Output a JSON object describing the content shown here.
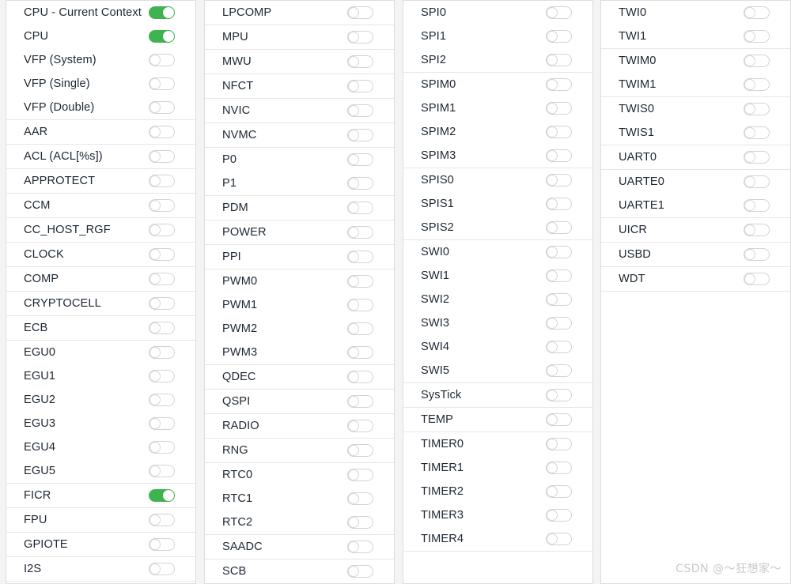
{
  "window": {
    "background_color": "#f4f4f4",
    "panel_color": "#ffffff",
    "panel_border_color": "#dddddd",
    "separator_color": "#e6e6e6",
    "label_color": "#1d2733",
    "toggle_on_color": "#3fb34f",
    "toggle_off_color": "#d3d3d3"
  },
  "watermark": {
    "text": "CSDN @～狂想家～"
  },
  "columns": [
    {
      "id": "column-1",
      "groups": [
        {
          "id": "group-cpu",
          "items": [
            {
              "label": "CPU - Current Context",
              "state": "on"
            },
            {
              "label": "CPU",
              "state": "on"
            },
            {
              "label": "VFP (System)",
              "state": "off"
            },
            {
              "label": "VFP (Single)",
              "state": "off"
            },
            {
              "label": "VFP (Double)",
              "state": "off"
            }
          ]
        },
        {
          "id": "group-aar",
          "items": [
            {
              "label": "AAR",
              "state": "off"
            }
          ]
        },
        {
          "id": "group-acl",
          "items": [
            {
              "label": "ACL (ACL[%s])",
              "state": "off"
            }
          ]
        },
        {
          "id": "group-approtect",
          "items": [
            {
              "label": "APPROTECT",
              "state": "off"
            }
          ]
        },
        {
          "id": "group-ccm",
          "items": [
            {
              "label": "CCM",
              "state": "off"
            }
          ]
        },
        {
          "id": "group-cc-host-rgf",
          "items": [
            {
              "label": "CC_HOST_RGF",
              "state": "off"
            }
          ]
        },
        {
          "id": "group-clock",
          "items": [
            {
              "label": "CLOCK",
              "state": "off"
            }
          ]
        },
        {
          "id": "group-comp",
          "items": [
            {
              "label": "COMP",
              "state": "off"
            }
          ]
        },
        {
          "id": "group-cryptocell",
          "items": [
            {
              "label": "CRYPTOCELL",
              "state": "off"
            }
          ]
        },
        {
          "id": "group-ecb",
          "items": [
            {
              "label": "ECB",
              "state": "off"
            }
          ]
        },
        {
          "id": "group-egu",
          "items": [
            {
              "label": "EGU0",
              "state": "off"
            },
            {
              "label": "EGU1",
              "state": "off"
            },
            {
              "label": "EGU2",
              "state": "off"
            },
            {
              "label": "EGU3",
              "state": "off"
            },
            {
              "label": "EGU4",
              "state": "off"
            },
            {
              "label": "EGU5",
              "state": "off"
            }
          ]
        },
        {
          "id": "group-ficr",
          "items": [
            {
              "label": "FICR",
              "state": "on"
            }
          ]
        },
        {
          "id": "group-fpu",
          "items": [
            {
              "label": "FPU",
              "state": "off"
            }
          ]
        },
        {
          "id": "group-gpiote",
          "items": [
            {
              "label": "GPIOTE",
              "state": "off"
            }
          ]
        },
        {
          "id": "group-i2s",
          "items": [
            {
              "label": "I2S",
              "state": "off"
            }
          ]
        }
      ]
    },
    {
      "id": "column-2",
      "groups": [
        {
          "id": "group-lpcomp",
          "items": [
            {
              "label": "LPCOMP",
              "state": "off"
            }
          ]
        },
        {
          "id": "group-mpu",
          "items": [
            {
              "label": "MPU",
              "state": "off"
            }
          ]
        },
        {
          "id": "group-mwu",
          "items": [
            {
              "label": "MWU",
              "state": "off"
            }
          ]
        },
        {
          "id": "group-nfct",
          "items": [
            {
              "label": "NFCT",
              "state": "off"
            }
          ]
        },
        {
          "id": "group-nvic",
          "items": [
            {
              "label": "NVIC",
              "state": "off"
            }
          ]
        },
        {
          "id": "group-nvmc",
          "items": [
            {
              "label": "NVMC",
              "state": "off"
            }
          ]
        },
        {
          "id": "group-ports",
          "items": [
            {
              "label": "P0",
              "state": "off"
            },
            {
              "label": "P1",
              "state": "off"
            }
          ]
        },
        {
          "id": "group-pdm",
          "items": [
            {
              "label": "PDM",
              "state": "off"
            }
          ]
        },
        {
          "id": "group-power",
          "items": [
            {
              "label": "POWER",
              "state": "off"
            }
          ]
        },
        {
          "id": "group-ppi",
          "items": [
            {
              "label": "PPI",
              "state": "off"
            }
          ]
        },
        {
          "id": "group-pwm",
          "items": [
            {
              "label": "PWM0",
              "state": "off"
            },
            {
              "label": "PWM1",
              "state": "off"
            },
            {
              "label": "PWM2",
              "state": "off"
            },
            {
              "label": "PWM3",
              "state": "off"
            }
          ]
        },
        {
          "id": "group-qdec",
          "items": [
            {
              "label": "QDEC",
              "state": "off"
            }
          ]
        },
        {
          "id": "group-qspi",
          "items": [
            {
              "label": "QSPI",
              "state": "off"
            }
          ]
        },
        {
          "id": "group-radio",
          "items": [
            {
              "label": "RADIO",
              "state": "off"
            }
          ]
        },
        {
          "id": "group-rng",
          "items": [
            {
              "label": "RNG",
              "state": "off"
            }
          ]
        },
        {
          "id": "group-rtc",
          "items": [
            {
              "label": "RTC0",
              "state": "off"
            },
            {
              "label": "RTC1",
              "state": "off"
            },
            {
              "label": "RTC2",
              "state": "off"
            }
          ]
        },
        {
          "id": "group-saadc",
          "items": [
            {
              "label": "SAADC",
              "state": "off"
            }
          ]
        },
        {
          "id": "group-scb",
          "items": [
            {
              "label": "SCB",
              "state": "off"
            }
          ]
        }
      ]
    },
    {
      "id": "column-3",
      "groups": [
        {
          "id": "group-spi",
          "items": [
            {
              "label": "SPI0",
              "state": "off"
            },
            {
              "label": "SPI1",
              "state": "off"
            },
            {
              "label": "SPI2",
              "state": "off"
            }
          ]
        },
        {
          "id": "group-spim",
          "items": [
            {
              "label": "SPIM0",
              "state": "off"
            },
            {
              "label": "SPIM1",
              "state": "off"
            },
            {
              "label": "SPIM2",
              "state": "off"
            },
            {
              "label": "SPIM3",
              "state": "off"
            }
          ]
        },
        {
          "id": "group-spis",
          "items": [
            {
              "label": "SPIS0",
              "state": "off"
            },
            {
              "label": "SPIS1",
              "state": "off"
            },
            {
              "label": "SPIS2",
              "state": "off"
            }
          ]
        },
        {
          "id": "group-swi",
          "items": [
            {
              "label": "SWI0",
              "state": "off"
            },
            {
              "label": "SWI1",
              "state": "off"
            },
            {
              "label": "SWI2",
              "state": "off"
            },
            {
              "label": "SWI3",
              "state": "off"
            },
            {
              "label": "SWI4",
              "state": "off"
            },
            {
              "label": "SWI5",
              "state": "off"
            }
          ]
        },
        {
          "id": "group-systick",
          "items": [
            {
              "label": "SysTick",
              "state": "off"
            }
          ]
        },
        {
          "id": "group-temp",
          "items": [
            {
              "label": "TEMP",
              "state": "off"
            }
          ]
        },
        {
          "id": "group-timer",
          "items": [
            {
              "label": "TIMER0",
              "state": "off"
            },
            {
              "label": "TIMER1",
              "state": "off"
            },
            {
              "label": "TIMER2",
              "state": "off"
            },
            {
              "label": "TIMER3",
              "state": "off"
            },
            {
              "label": "TIMER4",
              "state": "off"
            }
          ]
        }
      ]
    },
    {
      "id": "column-4",
      "groups": [
        {
          "id": "group-twi",
          "items": [
            {
              "label": "TWI0",
              "state": "off"
            },
            {
              "label": "TWI1",
              "state": "off"
            }
          ]
        },
        {
          "id": "group-twim",
          "items": [
            {
              "label": "TWIM0",
              "state": "off"
            },
            {
              "label": "TWIM1",
              "state": "off"
            }
          ]
        },
        {
          "id": "group-twis",
          "items": [
            {
              "label": "TWIS0",
              "state": "off"
            },
            {
              "label": "TWIS1",
              "state": "off"
            }
          ]
        },
        {
          "id": "group-uart",
          "items": [
            {
              "label": "UART0",
              "state": "off"
            }
          ]
        },
        {
          "id": "group-uarte",
          "items": [
            {
              "label": "UARTE0",
              "state": "off"
            },
            {
              "label": "UARTE1",
              "state": "off"
            }
          ]
        },
        {
          "id": "group-uicr",
          "items": [
            {
              "label": "UICR",
              "state": "off"
            }
          ]
        },
        {
          "id": "group-usbd",
          "items": [
            {
              "label": "USBD",
              "state": "off"
            }
          ]
        },
        {
          "id": "group-wdt",
          "items": [
            {
              "label": "WDT",
              "state": "off"
            }
          ]
        }
      ]
    }
  ]
}
